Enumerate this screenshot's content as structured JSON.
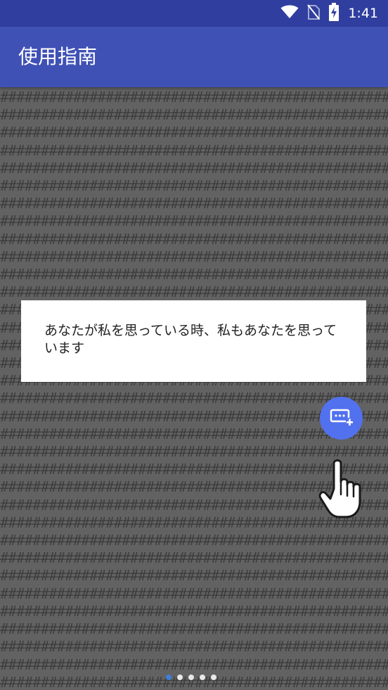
{
  "status_bar": {
    "time": "1:41",
    "icons": [
      "wifi-icon",
      "no-sim-icon",
      "battery-charging-icon"
    ]
  },
  "app_bar": {
    "title": "使用指南"
  },
  "guide": {
    "pattern_char": "#",
    "tip_text": "あなたが私を思っている時、私もあなたを思っています",
    "fab_icon": "add-message-icon",
    "hand_icon": "tap-hand-icon"
  },
  "pager": {
    "page_count": 5,
    "current_page": 1
  },
  "colors": {
    "status_bar": "#303f9f",
    "app_bar": "#3f51b5",
    "fab": "#5271ef",
    "active_dot": "#3f7fd9"
  }
}
